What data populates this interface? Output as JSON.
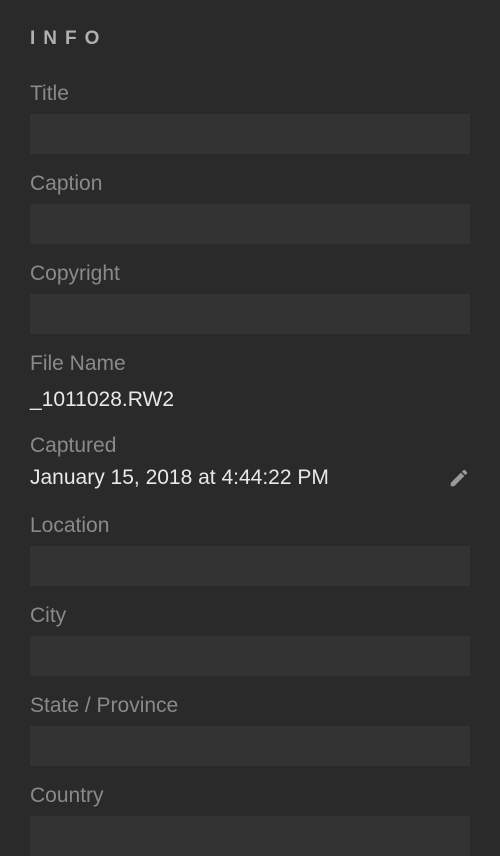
{
  "section": {
    "header": "INFO"
  },
  "fields": {
    "title": {
      "label": "Title",
      "value": ""
    },
    "caption": {
      "label": "Caption",
      "value": ""
    },
    "copyright": {
      "label": "Copyright",
      "value": ""
    },
    "filename": {
      "label": "File Name",
      "value": "_1011028.RW2"
    },
    "captured": {
      "label": "Captured",
      "value": "January 15, 2018 at 4:44:22 PM"
    },
    "location": {
      "label": "Location",
      "value": ""
    },
    "city": {
      "label": "City",
      "value": ""
    },
    "state": {
      "label": "State / Province",
      "value": ""
    },
    "country": {
      "label": "Country",
      "value": ""
    }
  }
}
